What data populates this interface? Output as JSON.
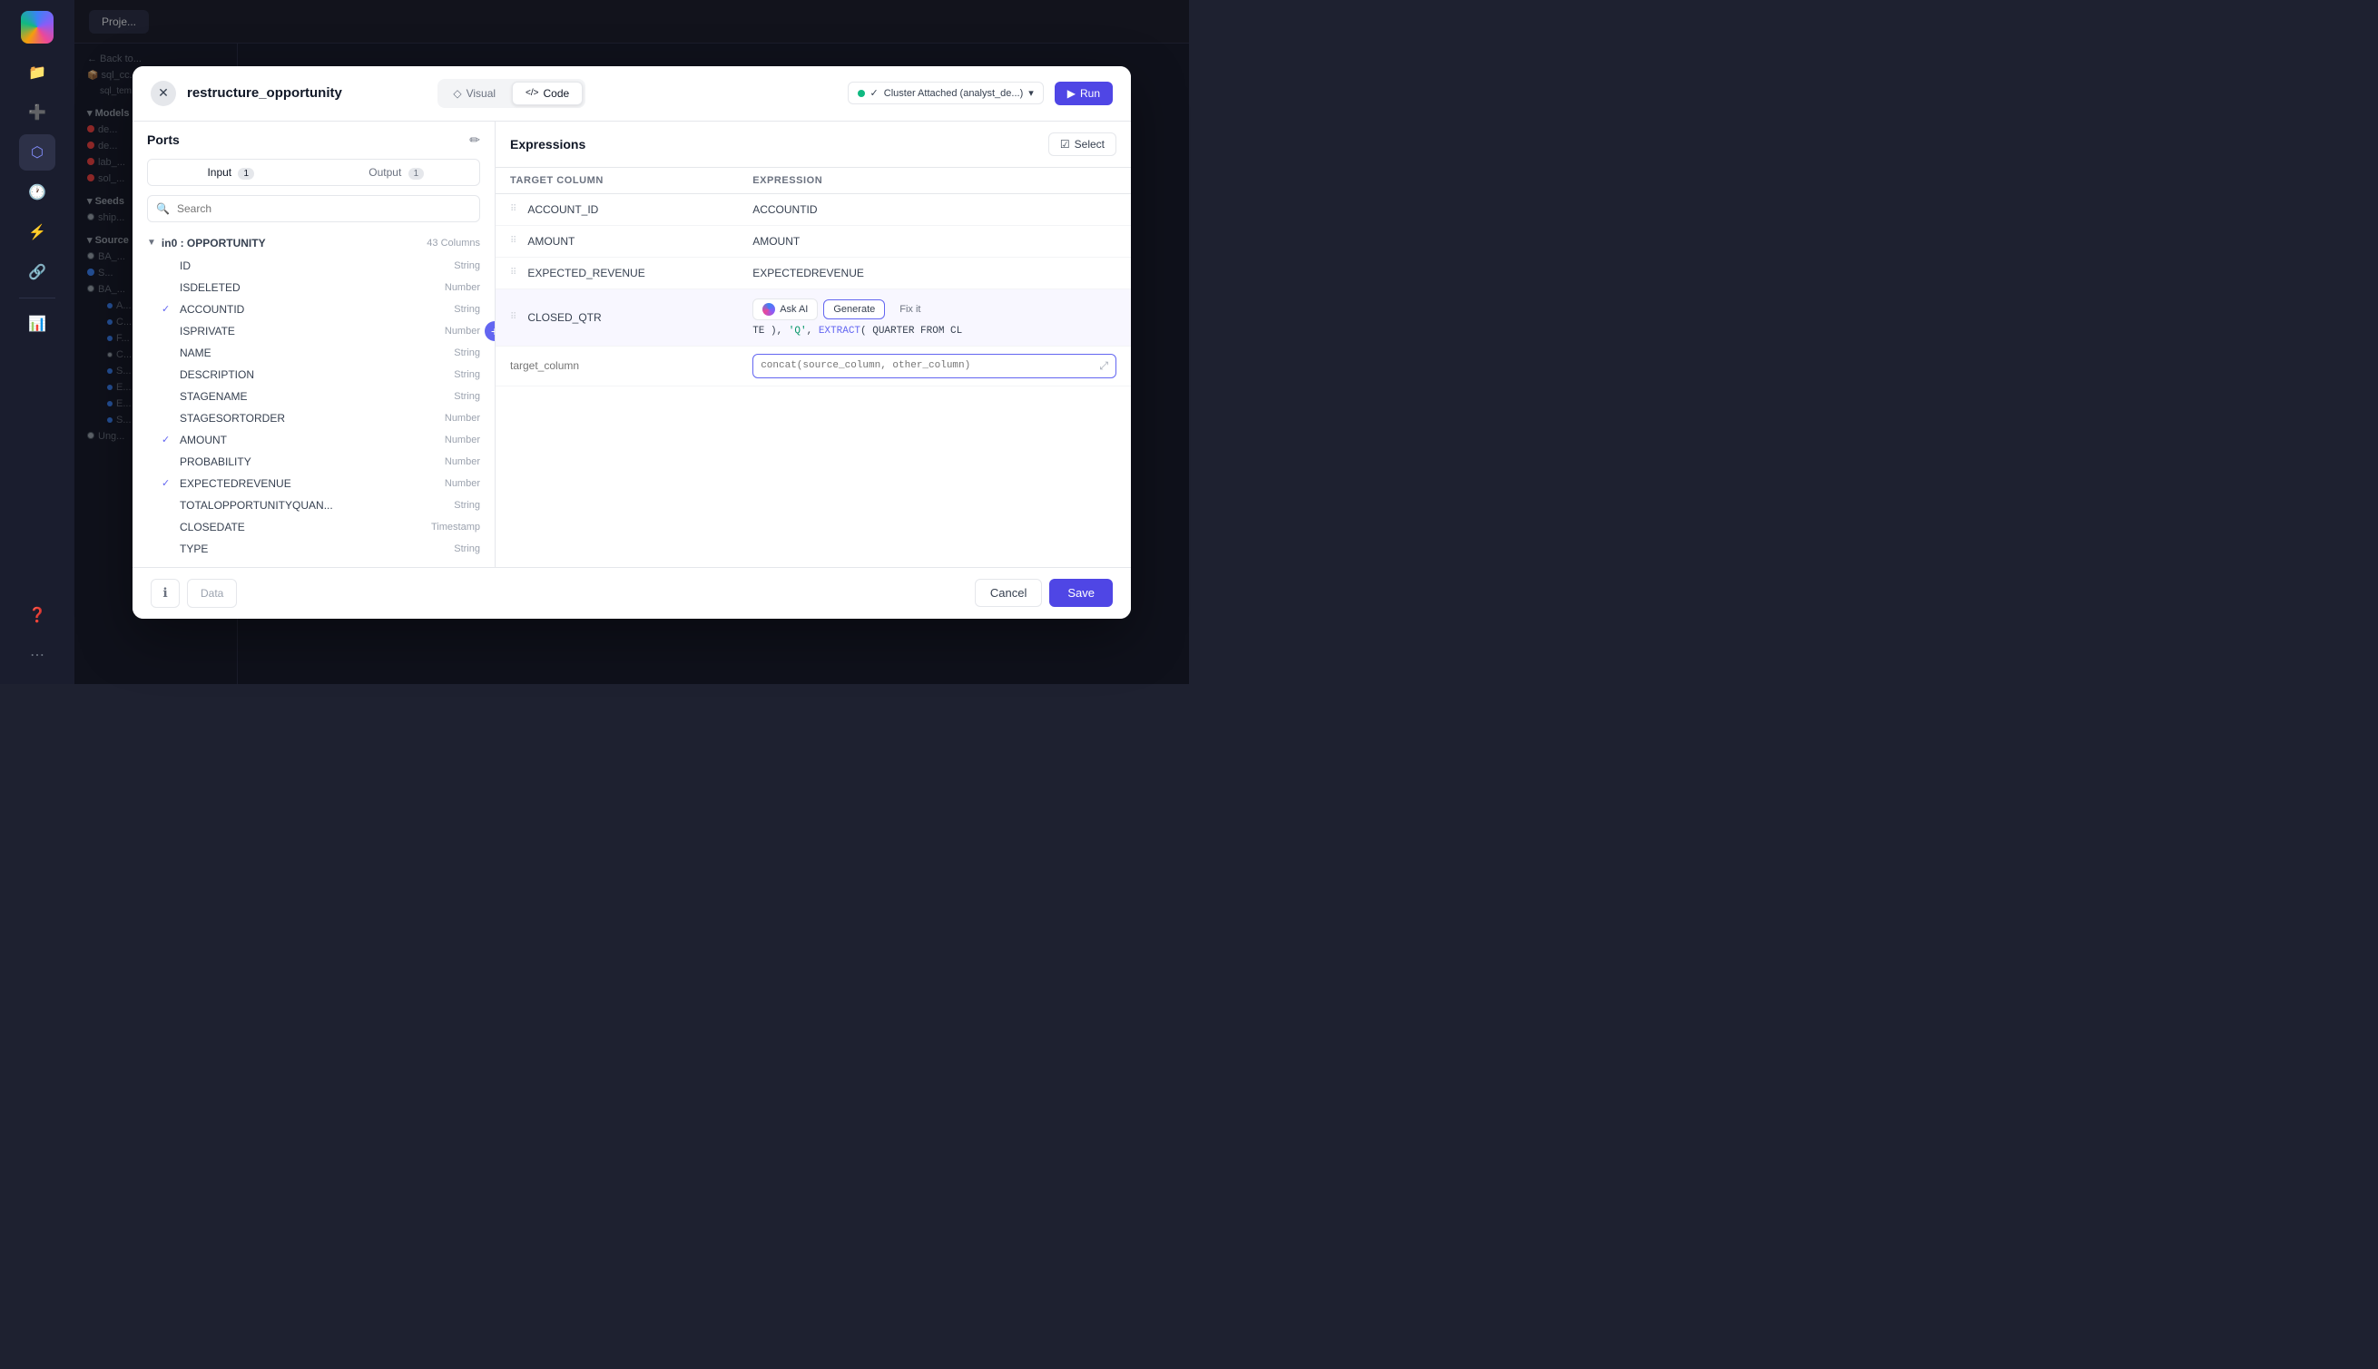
{
  "app": {
    "title": "restructure_opportunity"
  },
  "sidebar": {
    "icons": [
      "🔵",
      "📁",
      "➕",
      "⬡",
      "🕐",
      "⚡",
      "🔗",
      "📊",
      "❓",
      "⋯"
    ]
  },
  "modal": {
    "title": "restructure_opportunity",
    "close_label": "✕",
    "tabs": [
      {
        "id": "visual",
        "label": "Visual",
        "icon": "◇",
        "active": false
      },
      {
        "id": "code",
        "label": "Code",
        "icon": "</>",
        "active": true
      }
    ],
    "cluster": {
      "label": "Cluster Attached (analyst_de...)",
      "chevron": "▾"
    },
    "run_label": "Run"
  },
  "ports": {
    "title": "Ports",
    "input_tab": "Input",
    "input_count": "1",
    "output_tab": "Output",
    "output_count": "1",
    "search_placeholder": "Search",
    "section": {
      "label": "in0 : OPPORTUNITY",
      "count": "43 Columns"
    },
    "columns": [
      {
        "name": "ID",
        "type": "String",
        "checked": false
      },
      {
        "name": "ISDELETED",
        "type": "Number",
        "checked": false
      },
      {
        "name": "ACCOUNTID",
        "type": "String",
        "checked": true
      },
      {
        "name": "ISPRIVATE",
        "type": "Number",
        "checked": false
      },
      {
        "name": "NAME",
        "type": "String",
        "checked": false
      },
      {
        "name": "DESCRIPTION",
        "type": "String",
        "checked": false
      },
      {
        "name": "STAGENAME",
        "type": "String",
        "checked": false
      },
      {
        "name": "STAGESORTORDER",
        "type": "Number",
        "checked": false
      },
      {
        "name": "AMOUNT",
        "type": "Number",
        "checked": true
      },
      {
        "name": "PROBABILITY",
        "type": "Number",
        "checked": false
      },
      {
        "name": "EXPECTEDREVENUE",
        "type": "Number",
        "checked": true
      },
      {
        "name": "TOTALOPPORTUNITYQUAN...",
        "type": "String",
        "checked": false
      },
      {
        "name": "CLOSEDATE",
        "type": "Timestamp",
        "checked": false
      },
      {
        "name": "TYPE",
        "type": "String",
        "checked": false
      }
    ]
  },
  "expressions": {
    "title": "Expressions",
    "select_label": "Select",
    "select_icon": "☑",
    "col_header_target": "Target Column",
    "col_header_expr": "Expression",
    "rows": [
      {
        "id": "account_id",
        "target": "ACCOUNT_ID",
        "expr": "ACCOUNTID",
        "active": false
      },
      {
        "id": "amount",
        "target": "AMOUNT",
        "expr": "AMOUNT",
        "active": false
      },
      {
        "id": "expected_revenue",
        "target": "EXPECTED_REVENUE",
        "expr": "EXPECTEDREVENUE",
        "active": false
      },
      {
        "id": "closed_qtr",
        "target": "CLOSED_QTR",
        "expr_code": "TE ), 'Q', EXTRACT( QUARTER FROM CL",
        "active": true
      }
    ],
    "new_row": {
      "target_placeholder": "target_column",
      "expr_placeholder": "concat(source_column, other_column)"
    },
    "ai_tools": {
      "ask_ai_label": "Ask AI",
      "generate_label": "Generate",
      "fix_it_label": "Fix it"
    }
  },
  "footer": {
    "info_icon": "ℹ",
    "data_label": "Data",
    "cancel_label": "Cancel",
    "save_label": "Save"
  }
}
